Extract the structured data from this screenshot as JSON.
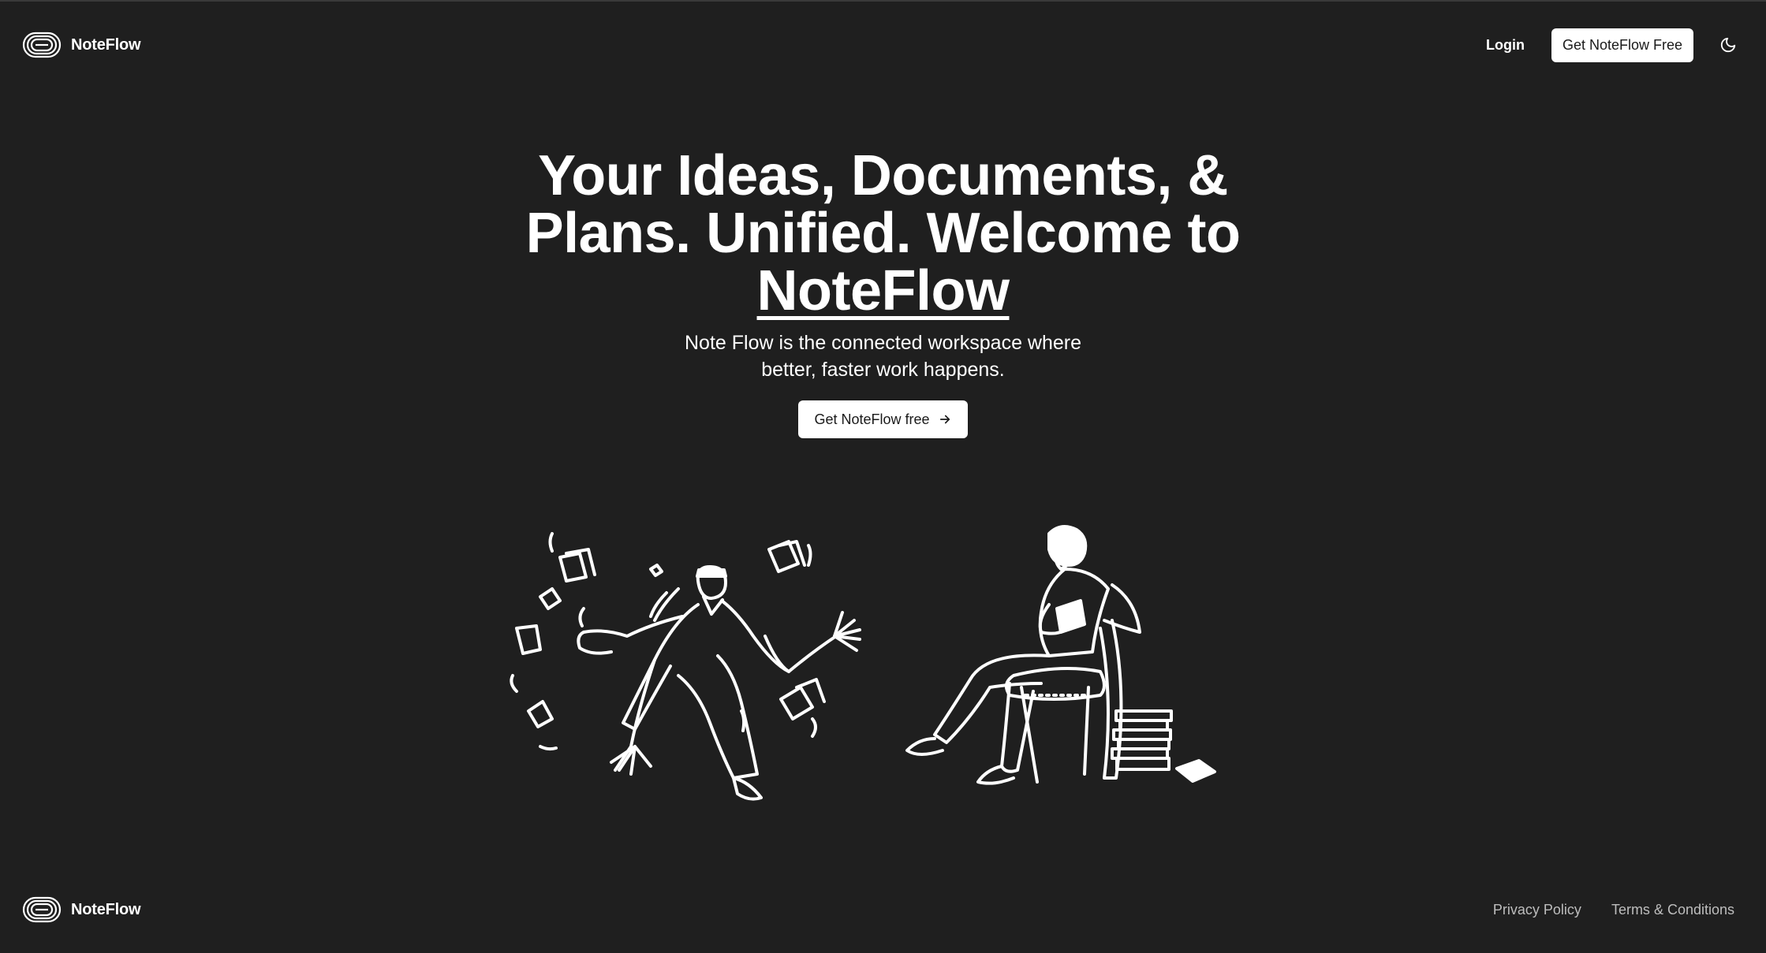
{
  "header": {
    "brand_name": "NoteFlow",
    "login_label": "Login",
    "cta_label": "Get NoteFlow Free",
    "theme_icon": "moon-icon"
  },
  "hero": {
    "title_lead": "Your Ideas, Documents, & Plans. Unified. Welcome to ",
    "title_brand": "NoteFlow",
    "subtitle": "Note Flow is the connected workspace where better, faster work happens.",
    "cta_label": "Get NoteFlow free",
    "cta_icon": "arrow-right-icon"
  },
  "footer": {
    "brand_name": "NoteFlow",
    "privacy_label": "Privacy Policy",
    "terms_label": "Terms & Conditions"
  },
  "colors": {
    "background": "#1f1f1f",
    "text": "#ffffff",
    "button_bg": "#ffffff",
    "button_text": "#1a1a1a",
    "footer_link": "#bdbdbd"
  }
}
